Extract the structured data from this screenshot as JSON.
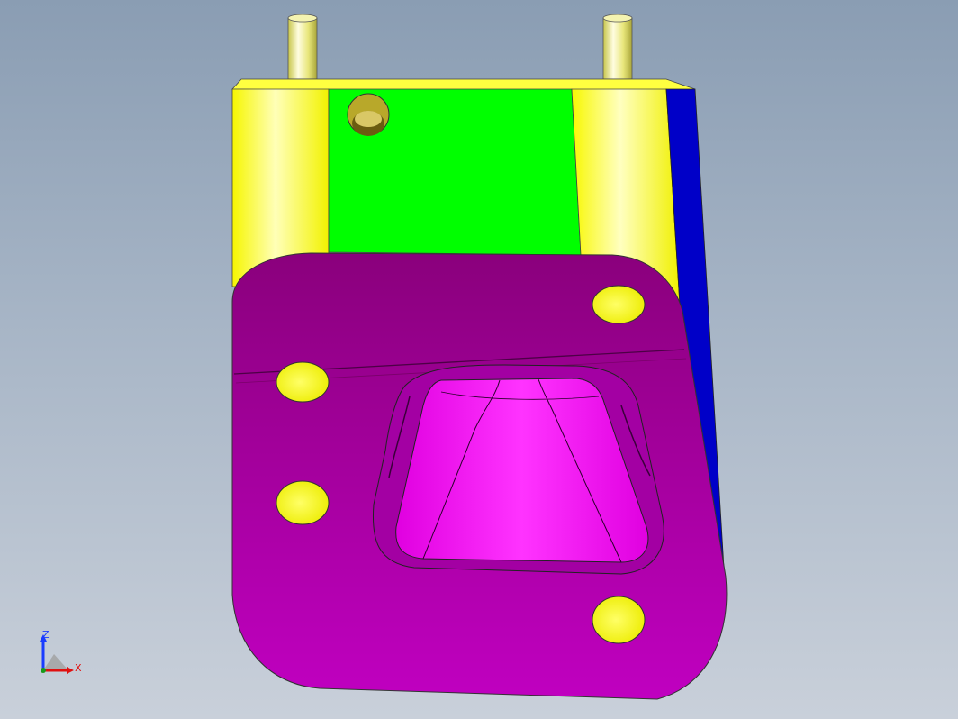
{
  "viewport": {
    "background_top": "#8a9db3",
    "background_bottom": "#c9d0da"
  },
  "model": {
    "colors": {
      "pin": "#e8e67a",
      "side_face": "#ffff00",
      "green_face": "#00ff00",
      "blue_face": "#0000c8",
      "plate_face": "#b000b0",
      "cavity_face": "#ff00ff",
      "hole_fill": "#ffff33"
    }
  },
  "triad": {
    "z_label": "Z",
    "x_label": "X",
    "z_color": "#1a3cff",
    "x_color": "#e01010",
    "y_color": "#1a9a1a"
  }
}
